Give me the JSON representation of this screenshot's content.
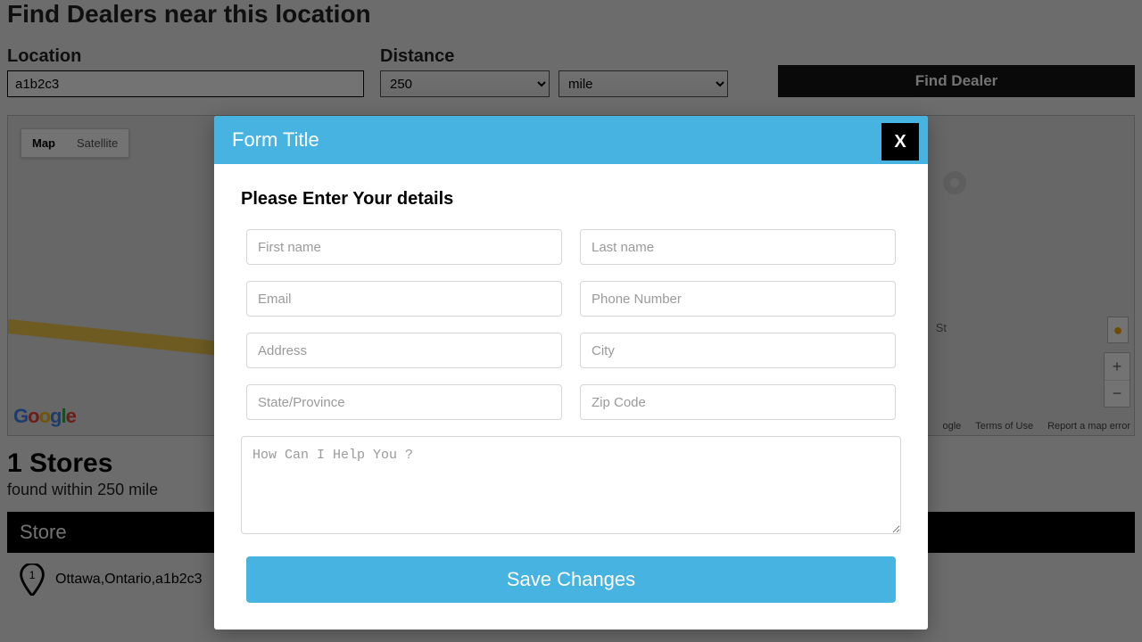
{
  "page": {
    "title": "Find Dealers near this location",
    "location_label": "Location",
    "location_value": "a1b2c3",
    "distance_label": "Distance",
    "distance_value": "250",
    "unit_value": "mile",
    "find_button": "Find Dealer"
  },
  "map": {
    "toggle_map": "Map",
    "toggle_satellite": "Satellite",
    "label_st": "St",
    "zoom_in": "+",
    "zoom_out": "−",
    "pegman": "☺",
    "footer_logo": "ogle",
    "footer_terms": "Terms of Use",
    "footer_report": "Report a map error"
  },
  "results": {
    "heading": "1 Stores",
    "sub": "found within 250 mile",
    "column_header": "Store",
    "pin_number": "1",
    "row_address": "Ottawa,Ontario,a1b2c3"
  },
  "modal": {
    "title": "Form Title",
    "close": "X",
    "subtitle": "Please Enter Your details",
    "placeholders": {
      "first_name": "First name",
      "last_name": "Last name",
      "email": "Email",
      "phone": "Phone Number",
      "address": "Address",
      "city": "City",
      "state": "State/Province",
      "zip": "Zip Code",
      "message": "How Can I Help You ?"
    },
    "save": "Save Changes"
  }
}
